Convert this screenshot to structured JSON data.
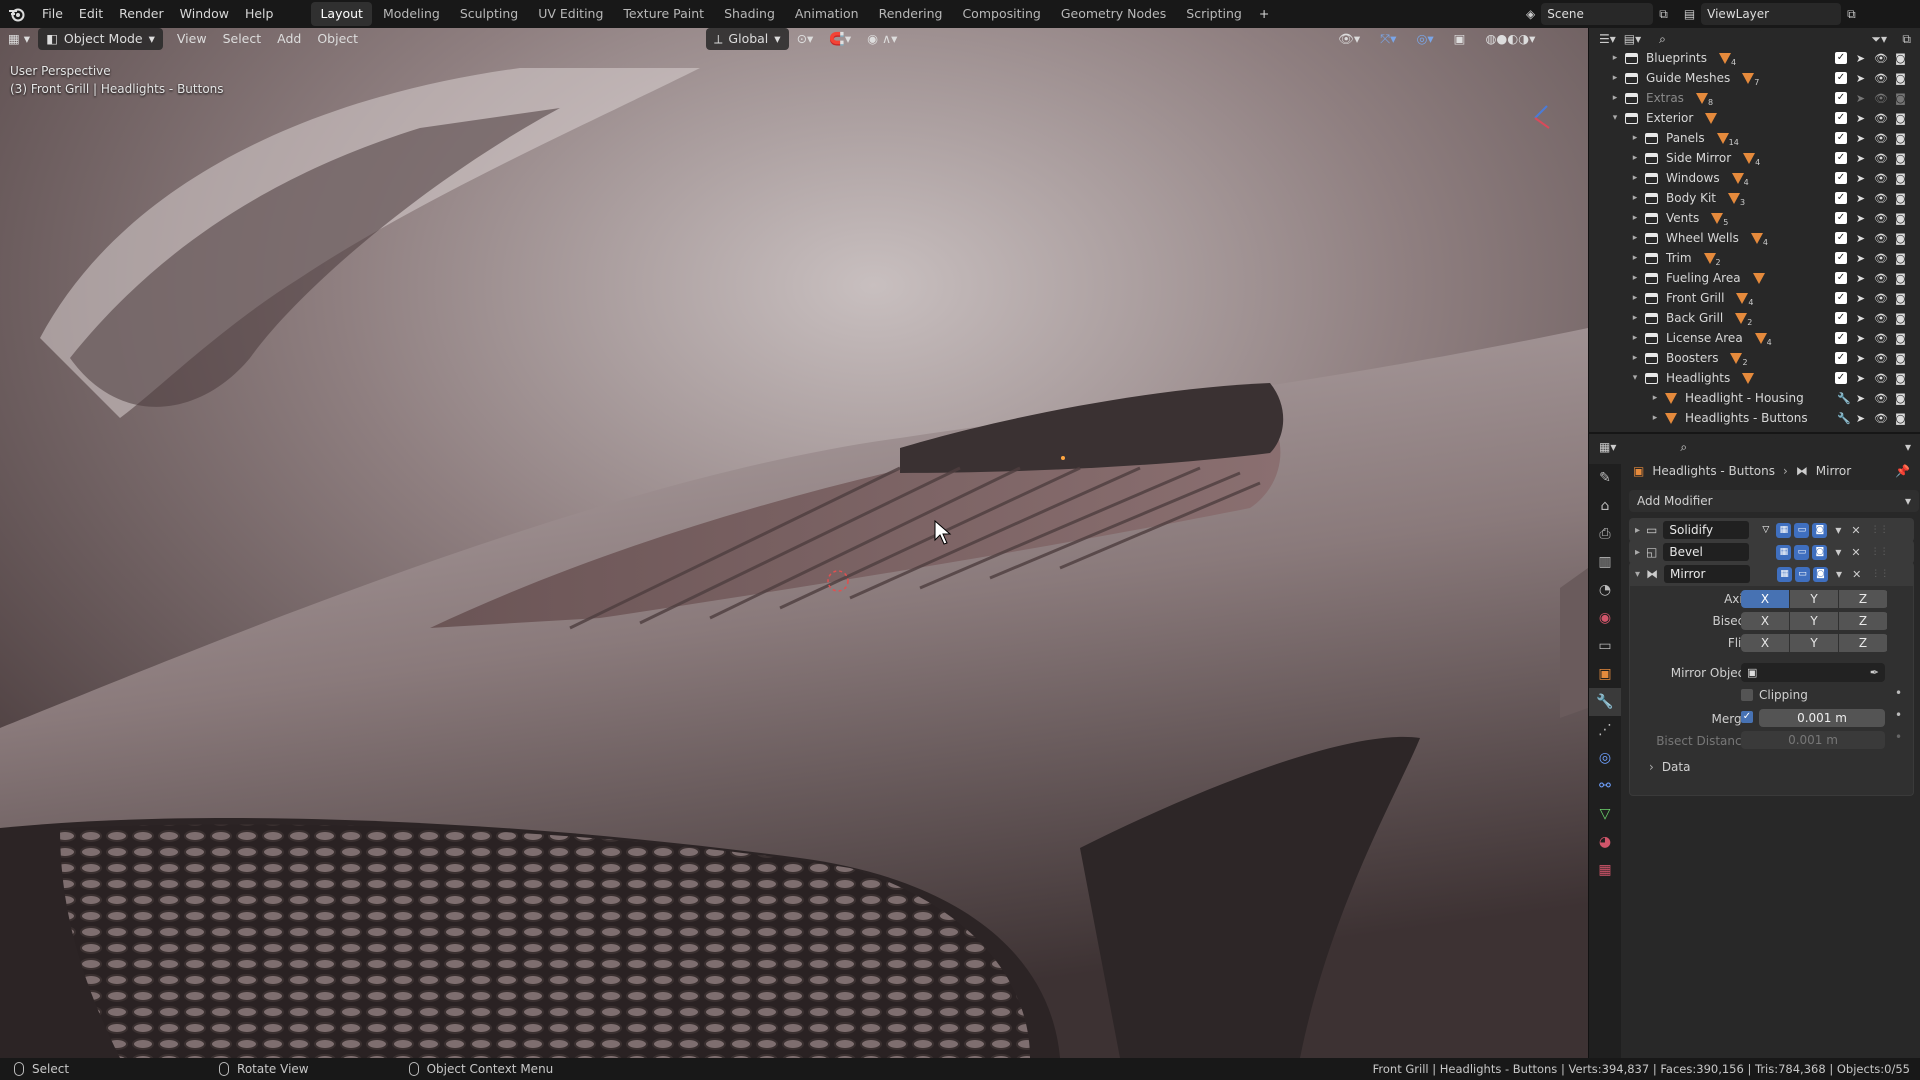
{
  "menu": [
    "File",
    "Edit",
    "Render",
    "Window",
    "Help"
  ],
  "workspaces": [
    "Layout",
    "Modeling",
    "Sculpting",
    "UV Editing",
    "Texture Paint",
    "Shading",
    "Animation",
    "Rendering",
    "Compositing",
    "Geometry Nodes",
    "Scripting"
  ],
  "active_workspace": "Layout",
  "add_tab": "+",
  "scene": "Scene",
  "view_layer": "ViewLayer",
  "viewport_header": {
    "mode": "Object Mode",
    "menus": [
      "View",
      "Select",
      "Add",
      "Object"
    ],
    "orientation": "Global"
  },
  "viewport_info": {
    "perspective": "User Perspective",
    "object": "(3) Front Grill | Headlights - Buttons"
  },
  "outliner": {
    "rows": [
      {
        "label": "Blueprints",
        "count": "4",
        "depth": 1,
        "kind": "collection",
        "expanded": false,
        "dim": false
      },
      {
        "label": "Guide Meshes",
        "count": "7",
        "depth": 1,
        "kind": "collection",
        "expanded": false,
        "dim": false
      },
      {
        "label": "Extras",
        "count": "8",
        "depth": 1,
        "kind": "collection",
        "expanded": false,
        "dim": true
      },
      {
        "label": "Exterior",
        "count": "",
        "depth": 1,
        "kind": "collection",
        "expanded": true,
        "dim": false
      },
      {
        "label": "Panels",
        "count": "14",
        "depth": 2,
        "kind": "collection",
        "expanded": false,
        "dim": false
      },
      {
        "label": "Side Mirror",
        "count": "4",
        "depth": 2,
        "kind": "collection",
        "expanded": false,
        "dim": false
      },
      {
        "label": "Windows",
        "count": "4",
        "depth": 2,
        "kind": "collection",
        "expanded": false,
        "dim": false
      },
      {
        "label": "Body Kit",
        "count": "3",
        "depth": 2,
        "kind": "collection",
        "expanded": false,
        "dim": false
      },
      {
        "label": "Vents",
        "count": "5",
        "depth": 2,
        "kind": "collection",
        "expanded": false,
        "dim": false
      },
      {
        "label": "Wheel Wells",
        "count": "4",
        "depth": 2,
        "kind": "collection",
        "expanded": false,
        "dim": false
      },
      {
        "label": "Trim",
        "count": "2",
        "depth": 2,
        "kind": "collection",
        "expanded": false,
        "dim": false
      },
      {
        "label": "Fueling Area",
        "count": "",
        "depth": 2,
        "kind": "collection",
        "expanded": false,
        "dim": false
      },
      {
        "label": "Front Grill",
        "count": "4",
        "depth": 2,
        "kind": "collection",
        "expanded": false,
        "dim": false
      },
      {
        "label": "Back Grill",
        "count": "2",
        "depth": 2,
        "kind": "collection",
        "expanded": false,
        "dim": false
      },
      {
        "label": "License Area",
        "count": "4",
        "depth": 2,
        "kind": "collection",
        "expanded": false,
        "dim": false
      },
      {
        "label": "Boosters",
        "count": "2",
        "depth": 2,
        "kind": "collection",
        "expanded": false,
        "dim": false
      },
      {
        "label": "Headlights",
        "count": "",
        "depth": 2,
        "kind": "collection",
        "expanded": true,
        "dim": false
      },
      {
        "label": "Headlight - Housing",
        "count": "",
        "depth": 3,
        "kind": "mesh",
        "expanded": false,
        "dim": false
      },
      {
        "label": "Headlights - Buttons",
        "count": "",
        "depth": 3,
        "kind": "mesh",
        "expanded": false,
        "dim": false
      }
    ]
  },
  "properties": {
    "breadcrumb_object": "Headlights - Buttons",
    "breadcrumb_modifier": "Mirror",
    "add_modifier": "Add Modifier",
    "modifiers": [
      "Solidify",
      "Bevel",
      "Mirror"
    ],
    "axis_label": "Axis",
    "bisect_label": "Bisect",
    "flip_label": "Flip",
    "axes": [
      "X",
      "Y",
      "Z"
    ],
    "mirror_object_label": "Mirror Object",
    "clipping_label": "Clipping",
    "merge_label": "Merge",
    "merge_value": "0.001 m",
    "bisect_distance_label": "Bisect Distance",
    "bisect_distance_value": "0.001 m",
    "data_label": "Data"
  },
  "statusbar": {
    "left": [
      {
        "label": "Select"
      },
      {
        "label": "Rotate View"
      },
      {
        "label": "Object Context Menu"
      }
    ],
    "stats": "Front Grill | Headlights - Buttons | Verts:394,837 | Faces:390,156 | Tris:784,368 | Objects:0/55"
  }
}
